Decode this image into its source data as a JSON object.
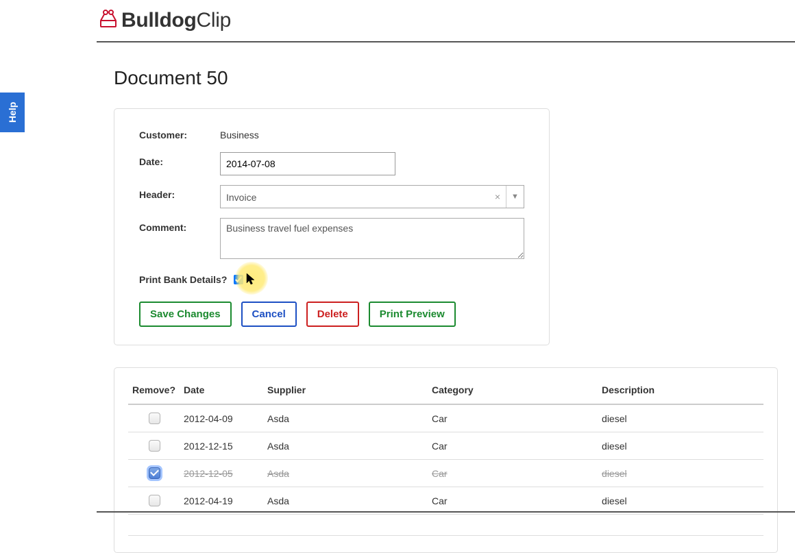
{
  "help_label": "Help",
  "logo": {
    "bold": "Bulldog",
    "thin": "Clip"
  },
  "page_title": "Document 50",
  "form": {
    "customer_label": "Customer:",
    "customer_value": "Business",
    "date_label": "Date:",
    "date_value": "2014-07-08",
    "header_label": "Header:",
    "header_value": "Invoice",
    "comment_label": "Comment:",
    "comment_value": "Business travel fuel expenses",
    "bank_label": "Print Bank Details?"
  },
  "buttons": {
    "save": "Save Changes",
    "cancel": "Cancel",
    "delete": "Delete",
    "preview": "Print Preview"
  },
  "table": {
    "headers": {
      "remove": "Remove?",
      "date": "Date",
      "supplier": "Supplier",
      "category": "Category",
      "description": "Description"
    },
    "rows": [
      {
        "removed": false,
        "date": "2012-04-09",
        "supplier": "Asda",
        "category": "Car",
        "description": "diesel"
      },
      {
        "removed": false,
        "date": "2012-12-15",
        "supplier": "Asda",
        "category": "Car",
        "description": "diesel"
      },
      {
        "removed": true,
        "date": "2012-12-05",
        "supplier": "Asda",
        "category": "Car",
        "description": "diesel"
      },
      {
        "removed": false,
        "date": "2012-04-19",
        "supplier": "Asda",
        "category": "Car",
        "description": "diesel"
      }
    ]
  }
}
